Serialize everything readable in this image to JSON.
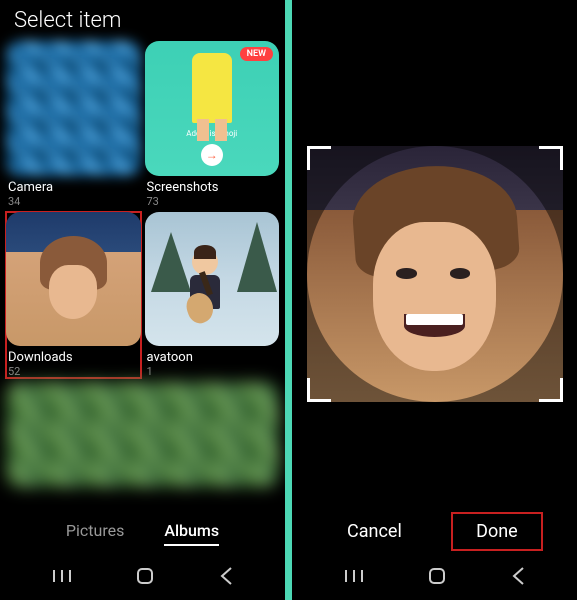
{
  "left": {
    "title": "Select item",
    "albums": [
      {
        "name": "Camera",
        "count": "34"
      },
      {
        "name": "Screenshots",
        "count": "73",
        "badge": "NEW",
        "caption": "Add this emoji",
        "arrow": "→"
      },
      {
        "name": "Downloads",
        "count": "52"
      },
      {
        "name": "avatoon",
        "count": "1"
      }
    ],
    "tabs": {
      "pictures": "Pictures",
      "albums": "Albums"
    }
  },
  "right": {
    "actions": {
      "cancel": "Cancel",
      "done": "Done"
    }
  },
  "colors": {
    "divider": "#4dd8b5",
    "highlight": "#c82020",
    "badge": "#ff4040"
  }
}
